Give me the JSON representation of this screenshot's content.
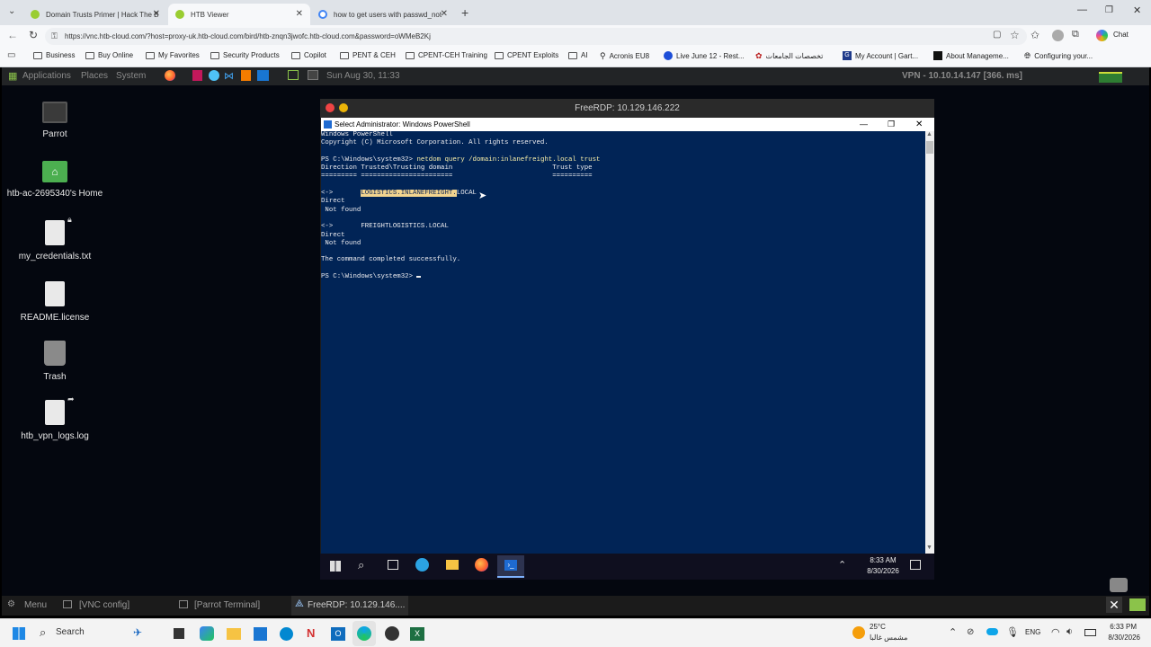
{
  "browser": {
    "tabs": [
      {
        "label": "Domain Trusts Primer | Hack The B",
        "active": false
      },
      {
        "label": "HTB Viewer",
        "active": true
      },
      {
        "label": "how to get users with passwd_not",
        "active": false
      }
    ],
    "url": "https://vnc.htb-cloud.com/?host=proxy-uk.htb-cloud.com/bird/htb-znqn3jwofc.htb-cloud.com&password=oWMeB2Kj",
    "bookmarks": [
      "Business",
      "Buy Online",
      "My Favorites",
      "Security Products",
      "Copilot",
      "PENT & CEH",
      "CPENT-CEH Training",
      "CPENT Exploits",
      "AI",
      "Acronis EU8",
      "Live June 12 - Rest...",
      "تخصصات الجامعات",
      "My Account | Gart...",
      "About Manageme...",
      "Configuring your..."
    ],
    "chat_label": "Chat"
  },
  "linux_panel": {
    "menus": [
      "Applications",
      "Places",
      "System"
    ],
    "clock": "Sun Aug 30, 11:33",
    "vpn": "VPN - 10.10.14.147 [366. ms]"
  },
  "desktop_icons": [
    {
      "label": "Parrot",
      "icon": "monitor-icon"
    },
    {
      "label": "htb-ac-2695340's Home",
      "icon": "home-folder-icon"
    },
    {
      "label": "my_credentials.txt",
      "icon": "text-file-icon"
    },
    {
      "label": "README.license",
      "icon": "text-file-icon"
    },
    {
      "label": "Trash",
      "icon": "trash-icon"
    },
    {
      "label": "htb_vpn_logs.log",
      "icon": "log-file-icon"
    }
  ],
  "rdp": {
    "title": "FreeRDP: 10.129.146.222",
    "ps_title": "Select Administrator: Windows PowerShell",
    "terminal_lines": {
      "l1": "Windows PowerShell",
      "l2": "Copyright (C) Microsoft Corporation. All rights reserved.",
      "prompt1": "PS C:\\Windows\\system32> ",
      "cmd": "netdom query /domain:inlanefreight.local trust",
      "hdr": "Direction Trusted\\Trusting domain                         Trust type",
      "rule": "========= =======================                         ==========",
      "arrow1": "<->       ",
      "dom1a": "LOGISTICS.INLANEFREIGHT.",
      "dom1b": "LOCAL",
      "direct1": "Direct",
      "nf1": " Not found",
      "row2": "<->       FREIGHTLOGISTICS.LOCAL",
      "direct2": "Direct",
      "nf2": " Not found",
      "done": "The command completed successfully.",
      "prompt2": "PS C:\\Windows\\system32> "
    },
    "win_clock_time": "8:33 AM",
    "win_clock_date": "8/30/2026"
  },
  "mate_panel": {
    "items": [
      "Menu",
      "[VNC config]",
      "[Parrot Terminal]",
      "FreeRDP: 10.129.146...."
    ]
  },
  "host_taskbar": {
    "search": "Search",
    "weather_temp": "25°C",
    "weather_text": "مشمس غالبا",
    "lang": "ENG",
    "time": "6:33 PM",
    "date": "8/30/2026"
  },
  "colors": {
    "ps_bg": "#012456",
    "highlight": "#f2d48f",
    "desktop_bg": "#04070f"
  }
}
